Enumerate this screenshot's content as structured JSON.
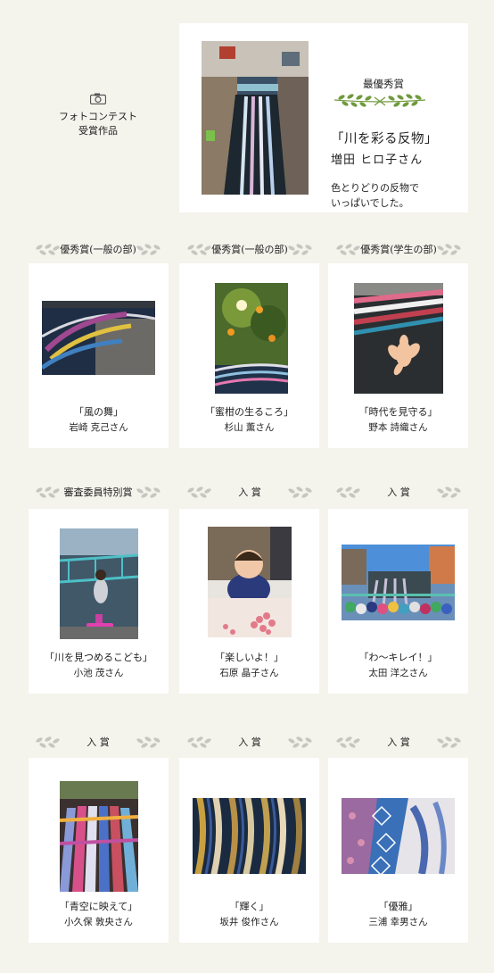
{
  "header": {
    "label_line1": "フォトコンテスト",
    "label_line2": "受賞作品",
    "camera_icon": "camera-icon"
  },
  "grand_prize": {
    "award": "最優秀賞",
    "title": "「川を彩る反物」",
    "name": "増田 ヒロ子さん",
    "comment_line1": "色とりどりの反物で",
    "comment_line2": "いっぱいでした。"
  },
  "categories": {
    "row1": [
      "優秀賞(一般の部)",
      "優秀賞(一般の部)",
      "優秀賞(学生の部)"
    ],
    "row2": [
      "審査委員特別賞",
      "入 賞",
      "入 賞"
    ],
    "row3": [
      "入 賞",
      "入 賞",
      "入 賞"
    ]
  },
  "entries": [
    {
      "title": "「風の舞」",
      "name": "岩崎 克己さん"
    },
    {
      "title": "「蜜柑の生るころ」",
      "name": "杉山 薫さん"
    },
    {
      "title": "「時代を見守る」",
      "name": "野本 詩織さん"
    },
    {
      "title": "「川を見つめるこども」",
      "name": "小池 茂さん"
    },
    {
      "title": "「楽しいよ！」",
      "name": "石原 晶子さん"
    },
    {
      "title": "「わ〜キレイ！」",
      "name": "太田 洋之さん"
    },
    {
      "title": "「青空に映えて」",
      "name": "小久保 敦央さん"
    },
    {
      "title": "「輝く」",
      "name": "坂井 俊作さん"
    },
    {
      "title": "「優雅」",
      "name": "三浦 幸男さん"
    }
  ],
  "colors": {
    "background": "#f4f3ec",
    "card": "#ffffff",
    "laurel_green": "#6f9a3c",
    "laurel_grey": "#c6c6c0"
  }
}
